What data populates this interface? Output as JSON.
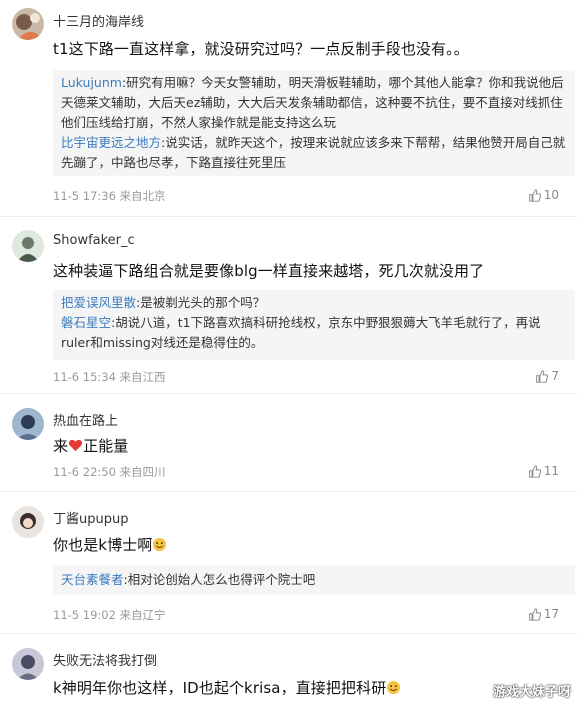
{
  "comments": [
    {
      "author": "十三月的海岸线",
      "text": "t1这下路一直这样拿，就没研究过吗？一点反制手段也没有。。",
      "replies": [
        {
          "user": "Lukujunm",
          "sep": ":",
          "text": "研究有用嘛？今天女警辅助，明天滑板鞋辅助，哪个其他人能拿？你和我说他后天德莱文辅助，大后天ez辅助，大大后天发条辅助都信，这种要不抗住，要不直接对线抓住他们压线给打崩，不然人家操作就是能支持这么玩"
        },
        {
          "user": "比宇宙更远之地方",
          "sep": ":",
          "text": "说实话，就昨天这个，按理来说就应该多来下帮帮，结果他赞开局自己就先蹦了，中路也尽孝，下路直接往死里压"
        }
      ],
      "date": "11-5 17:36",
      "location": "来自北京",
      "likes": "10"
    },
    {
      "author": "Showfaker_c",
      "text": "这种装逼下路组合就是要像blg一样直接来越塔，死几次就没用了",
      "replies": [
        {
          "user": "把爱误风里散",
          "sep": ":",
          "text": "是被剃光头的那个吗？"
        },
        {
          "user": "磐石星空",
          "sep": ":",
          "text": "胡说八道，t1下路喜欢搞科研抢线权，京东中野狠狠薅大飞羊毛就行了，再说ruler和missing对线还是稳得住的。"
        }
      ],
      "date": "11-6 15:34",
      "location": "来自江西",
      "likes": "7"
    },
    {
      "author": "热血在路上",
      "text_before": "来",
      "text_after": "正能量",
      "date": "11-6 22:50",
      "location": "来自四川",
      "likes": "11"
    },
    {
      "author": "丁酱upupup",
      "text": "你也是k博士啊",
      "replies": [
        {
          "user": "天台素餐者",
          "sep": ":",
          "text": "相对论创始人怎么也得评个院士吧"
        }
      ],
      "date": "11-5 19:02",
      "location": "来自辽宁",
      "likes": "17"
    },
    {
      "author": "失败无法将我打倒",
      "text": "k神明年你也这样，ID也起个krisa，直接把把科研"
    }
  ],
  "watermark": "游戏大妹子呀",
  "colors": {
    "link": "#3b7bbf",
    "meta": "#9a9a9a",
    "reply_bg": "#f5f5f5"
  },
  "icons": {
    "like": "thumbs-up-icon",
    "heart": "heart-emoji-icon",
    "smile": "smile-emoji-icon"
  }
}
